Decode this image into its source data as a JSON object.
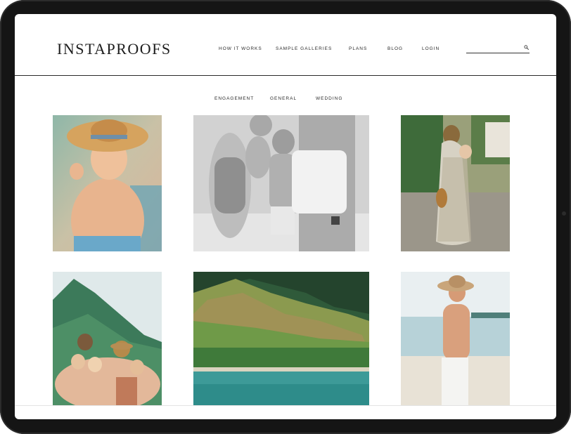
{
  "brand": {
    "logo_text": "INSTAPROOFS"
  },
  "nav": {
    "items": [
      {
        "label": "HOW IT WORKS"
      },
      {
        "label": "SAMPLE GALLERIES"
      },
      {
        "label": "PLANS"
      },
      {
        "label": "BLOG"
      },
      {
        "label": "LOGIN"
      }
    ]
  },
  "search": {
    "value": "",
    "placeholder": ""
  },
  "filters": [
    {
      "label": "ENGAGEMENT"
    },
    {
      "label": "GENERAL"
    },
    {
      "label": "WEDDING"
    }
  ],
  "gallery": {
    "photos": [
      {
        "icon": "photo-boy-straw-hat"
      },
      {
        "icon": "photo-family-black-white"
      },
      {
        "icon": "photo-mother-child-path"
      },
      {
        "icon": "photo-family-mountain"
      },
      {
        "icon": "photo-coastline-cliffs"
      },
      {
        "icon": "photo-man-beach-hat"
      }
    ]
  },
  "colors": {
    "bezel": "#151515",
    "text": "#1d1d1d",
    "divider": "#2a2a2a"
  }
}
